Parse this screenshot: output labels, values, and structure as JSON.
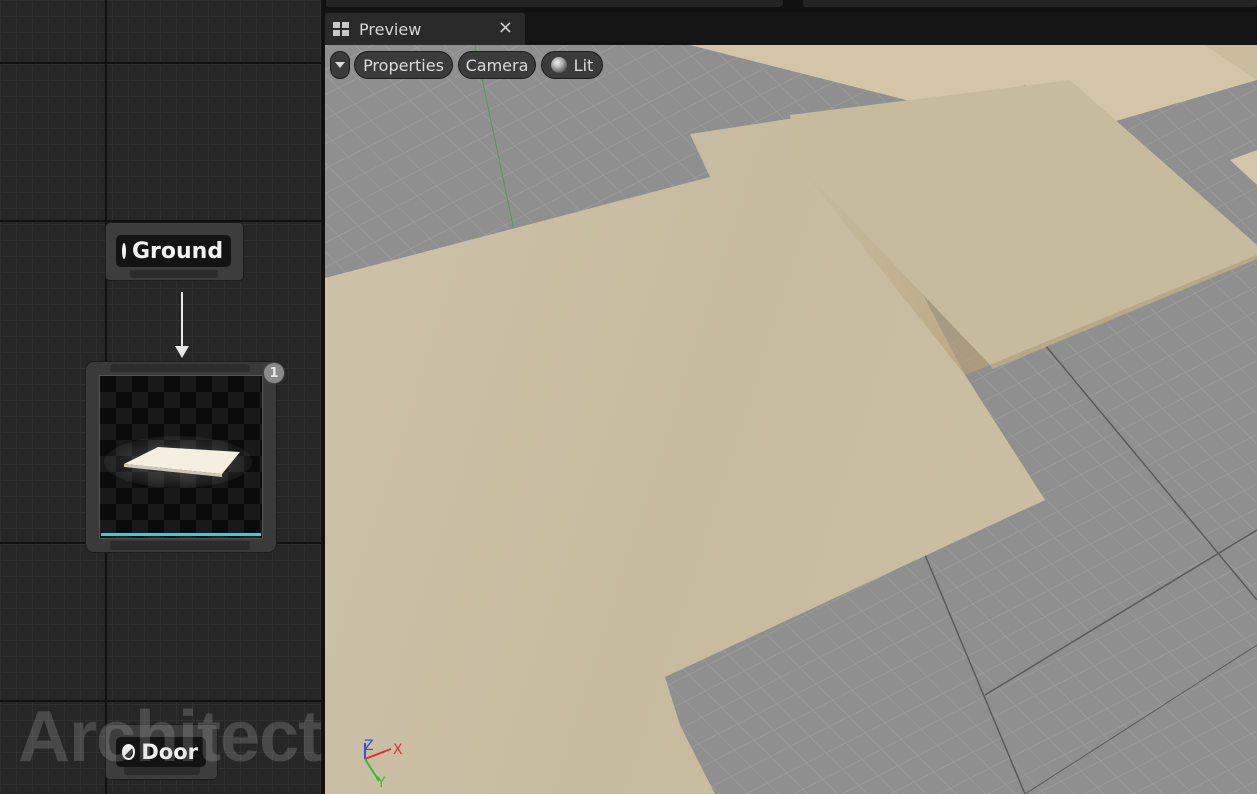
{
  "graph": {
    "nodes": {
      "ground": {
        "label": "Ground"
      },
      "mesh": {
        "badge": "1"
      },
      "door": {
        "label": "Door"
      }
    },
    "watermark": "Architect"
  },
  "preview": {
    "tab": {
      "title": "Preview",
      "close_glyph": "×"
    },
    "toolbar": {
      "properties_label": "Properties",
      "camera_label": "Camera",
      "lit_label": "Lit"
    },
    "axis_labels": {
      "z": "Z",
      "x": "X",
      "y": "Y"
    }
  },
  "icons": {
    "tab": "viewport-layout-icon",
    "node": "half-circle-icon",
    "lit": "sphere-icon",
    "menu": "chevron-down-icon"
  },
  "colors": {
    "accent": "#1fd8e8",
    "floor": "#cbbfa4",
    "grid": "#8c8c8c",
    "axis_x": "#e03030",
    "axis_y": "#30c030",
    "axis_z": "#3050e0"
  }
}
